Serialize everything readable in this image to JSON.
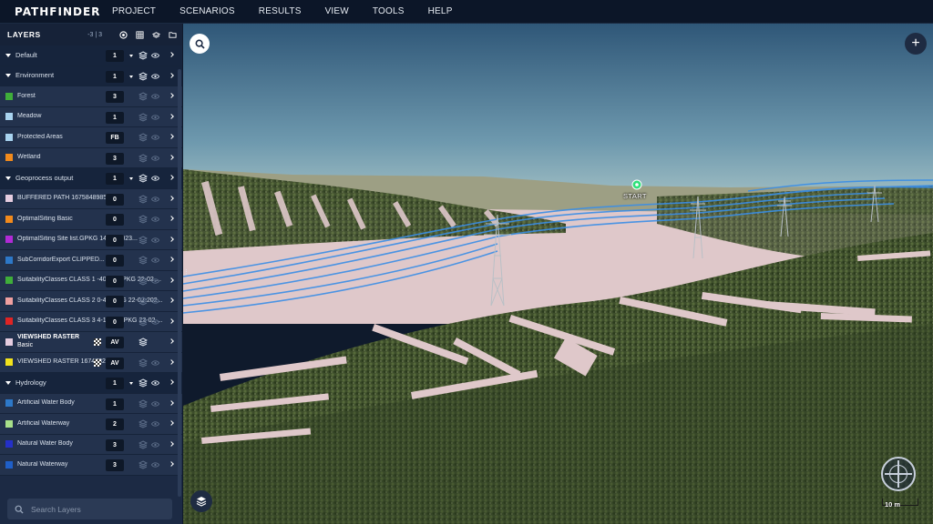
{
  "app": {
    "logo": "PATHFINDER",
    "menu": [
      "PROJECT",
      "SCENARIOS",
      "RESULTS",
      "VIEW",
      "TOOLS",
      "HELP"
    ]
  },
  "sidebar": {
    "title": "LAYERS",
    "count": "-3 | 3",
    "header_icons": [
      "target-icon",
      "grid-icon",
      "layer-add-icon",
      "folder-icon"
    ],
    "groups": [
      {
        "name": "Default",
        "badge": "1",
        "layers": []
      },
      {
        "name": "Environment",
        "badge": "1",
        "layers": [
          {
            "label": "Forest",
            "color": "#3fae3a",
            "badge": "3"
          },
          {
            "label": "Meadow",
            "color": "#a8d3ef",
            "badge": "1"
          },
          {
            "label": "Protected Areas",
            "color": "#a8d3ef",
            "badge": "FB"
          },
          {
            "label": "Wetland",
            "color": "#f28a1c",
            "badge": "3"
          }
        ]
      },
      {
        "name": "Geoprocess output",
        "badge": "1",
        "layers": [
          {
            "label": "BUFFERED PATH 1675848985",
            "color": "#e6cde0",
            "badge": "0"
          },
          {
            "label": "OptimalSiting Basic",
            "color": "#f28a1c",
            "badge": "0"
          },
          {
            "label": "OptimalSiting Site list.GPKG 14-09-2023...",
            "color": "#b12ad6",
            "badge": "0"
          },
          {
            "label": "SubCorridorExport CLIPPED...",
            "color": "#2d78c8",
            "badge": "0"
          },
          {
            "label": "SuitabilityClasses CLASS 1 -400-0.GPKG 22-02-...",
            "color": "#3fae3a",
            "badge": "0"
          },
          {
            "label": "SuitabilityClasses CLASS 2 0-4.GPKG 22-02-202...",
            "color": "#f0a0a0",
            "badge": "0"
          },
          {
            "label": "SuitabilityClasses CLASS 3 4-1204.GPKG 22-02-...",
            "color": "#e02424",
            "badge": "0"
          },
          {
            "label_bold": "VIEWSHED RASTER",
            "label_sub": "Basic",
            "color": "#e6cde0",
            "badge": "AV",
            "raster": true,
            "active": true
          },
          {
            "label": "VIEWSHED RASTER 1674732352",
            "color": "#f2e21c",
            "badge": "AV",
            "raster": true
          }
        ]
      },
      {
        "name": "Hydrology",
        "badge": "1",
        "layers": [
          {
            "label": "Artificial Water Body",
            "color": "#2d78c8",
            "badge": "1"
          },
          {
            "label": "Artificial Waterway",
            "color": "#a8e08a",
            "badge": "2"
          },
          {
            "label": "Natural Water Body",
            "color": "#2430c8",
            "badge": "3"
          },
          {
            "label": "Natural Waterway",
            "color": "#1f5fc8",
            "badge": "3"
          }
        ]
      }
    ],
    "search": {
      "placeholder": "Search Layers"
    }
  },
  "view": {
    "start_label": "START",
    "scale_label": "10 m"
  }
}
